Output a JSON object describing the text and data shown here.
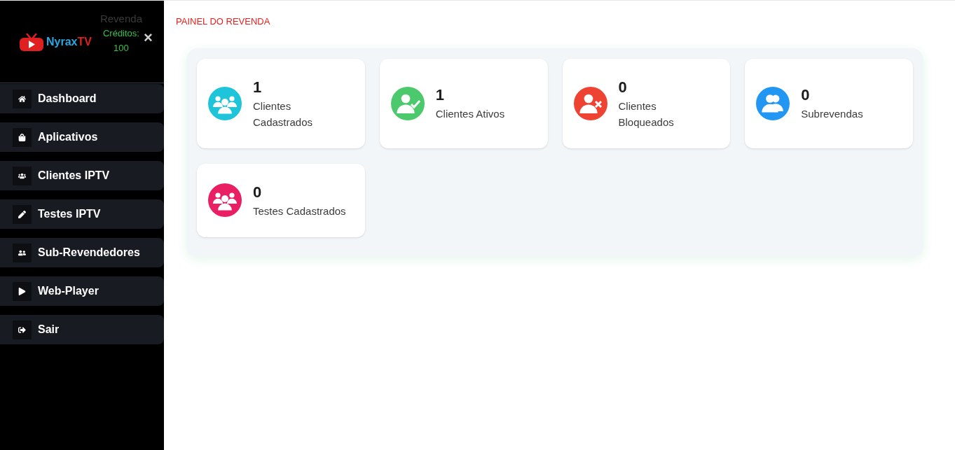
{
  "sidebar": {
    "logo": {
      "name_part": "Nyrax",
      "accent_part": "TV"
    },
    "role": "Revenda",
    "credits_label": "Créditos:",
    "credits_value": "100",
    "close": "×",
    "items": [
      {
        "label": "Dashboard",
        "kind": "home",
        "selected": false
      },
      {
        "label": "Aplicativos",
        "kind": "bag",
        "selected": false
      },
      {
        "label": "Clientes IPTV",
        "kind": "group",
        "selected": false
      },
      {
        "label": "Testes IPTV",
        "kind": "pen",
        "selected": false
      },
      {
        "label": "Sub-Revendedores",
        "kind": "users",
        "selected": false
      },
      {
        "label": "Web-Player",
        "kind": "play",
        "selected": false
      },
      {
        "label": "Sair",
        "kind": "logout",
        "selected": false
      }
    ]
  },
  "page_title": "PAINEL DO REVENDA",
  "stats": [
    {
      "value": "1",
      "label": "Clientes Cadastrados",
      "kind": "group",
      "color": "#1ec4d9"
    },
    {
      "value": "1",
      "label": "Clientes Ativos",
      "kind": "user-check",
      "color": "#4cc96c"
    },
    {
      "value": "0",
      "label": "Clientes Bloqueados",
      "kind": "user-x",
      "color": "#ee4232"
    },
    {
      "value": "0",
      "label": "Subrevendas",
      "kind": "users",
      "color": "#2196f3"
    },
    {
      "value": "0",
      "label": "Testes Cadastrados",
      "kind": "group",
      "color": "#e91e63"
    }
  ]
}
